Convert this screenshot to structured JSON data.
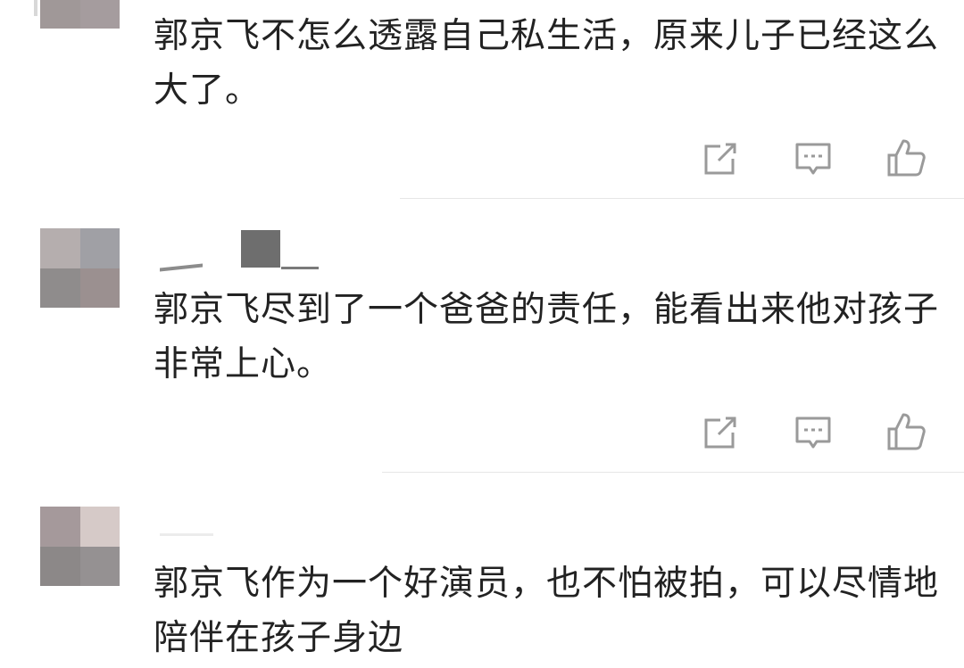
{
  "colors": {
    "text": "#222222",
    "icon": "#9a9a9a",
    "divider": "#e6e6e6"
  },
  "comments": [
    {
      "text": "郭京飞不怎么透露自己私生活，原来儿子已经这么大了。",
      "avatar_tiles": [
        "#9e9898",
        "#a89a9c",
        "#a09898",
        "#a59c9e"
      ],
      "actions": [
        "share-icon",
        "reply-icon",
        "like-icon"
      ]
    },
    {
      "text": "郭京飞尽到了一个爸爸的责任，能看出来他对孩子非常上心。",
      "avatar_tiles": [
        "#b5aeae",
        "#a0a0a5",
        "#8f8c8c",
        "#9b9090"
      ],
      "actions": [
        "share-icon",
        "reply-icon",
        "like-icon"
      ]
    },
    {
      "text": "郭京飞作为一个好演员，也不怕被拍，可以尽情地陪伴在孩子身边",
      "avatar_tiles": [
        "#a5999b",
        "#d6cac8",
        "#8c8888",
        "#959192"
      ],
      "actions": []
    }
  ]
}
